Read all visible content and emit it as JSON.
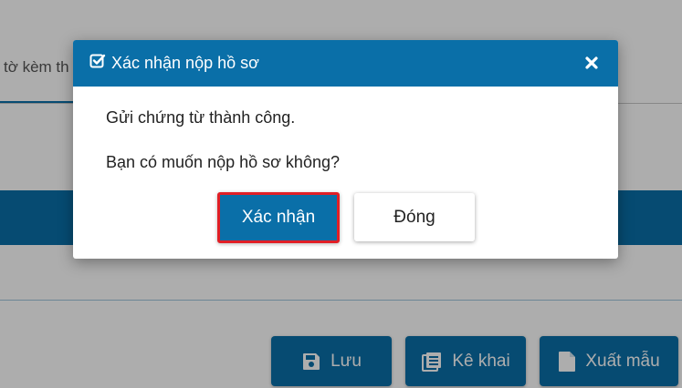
{
  "background": {
    "tab_label": "tờ kèm th",
    "buttons": {
      "save_label": "Lưu",
      "declare_label": "Kê khai",
      "export_label": "Xuất mẫu"
    }
  },
  "dialog": {
    "title": "Xác nhận nộp hồ sơ",
    "message_1": "Gửi chứng từ thành công.",
    "message_2": "Bạn có muốn nộp hồ sơ không?",
    "confirm_label": "Xác nhận",
    "close_label": "Đóng"
  },
  "icons": {
    "title": "check-square-icon",
    "close": "close-icon",
    "save": "floppy-disk-icon",
    "declare": "list-document-icon",
    "export": "file-icon"
  },
  "colors": {
    "primary": "#0a6fa8",
    "highlight_border": "#e11f26",
    "overlay": "rgba(0,0,0,0.32)"
  }
}
